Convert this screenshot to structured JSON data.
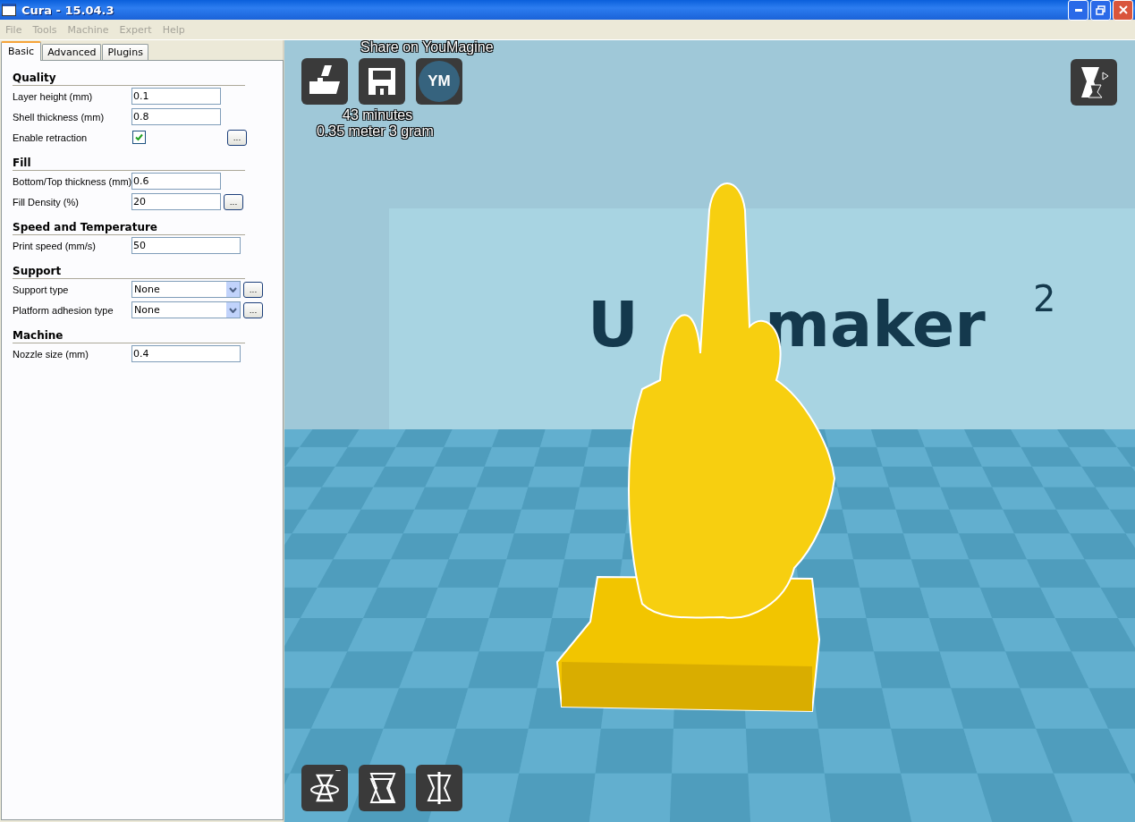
{
  "window": {
    "title": "Cura - 15.04.3"
  },
  "menu": [
    "File",
    "Tools",
    "Machine",
    "Expert",
    "Help"
  ],
  "tabs": [
    {
      "label": "Basic",
      "selected": true
    },
    {
      "label": "Advanced",
      "selected": false
    },
    {
      "label": "Plugins",
      "selected": false
    }
  ],
  "sections": [
    {
      "title": "Quality",
      "rows": [
        {
          "kind": "text",
          "label": "Layer height (mm)",
          "value": "0.1"
        },
        {
          "kind": "text",
          "label": "Shell thickness (mm)",
          "value": "0.8"
        },
        {
          "kind": "check",
          "label": "Enable retraction",
          "checked": true,
          "more_button": "..."
        }
      ]
    },
    {
      "title": "Fill",
      "rows": [
        {
          "kind": "text",
          "label": "Bottom/Top thickness (mm)",
          "value": "0.6"
        },
        {
          "kind": "text",
          "label": "Fill Density (%)",
          "value": "20",
          "more_button": "..."
        }
      ]
    },
    {
      "title": "Speed and Temperature",
      "rows": [
        {
          "kind": "text",
          "label": "Print speed (mm/s)",
          "value": "50",
          "wide": true
        }
      ]
    },
    {
      "title": "Support",
      "rows": [
        {
          "kind": "select",
          "label": "Support type",
          "value": "None",
          "more_button": "..."
        },
        {
          "kind": "select",
          "label": "Platform adhesion type",
          "value": "None",
          "more_button": "..."
        }
      ]
    },
    {
      "title": "Machine",
      "rows": [
        {
          "kind": "text",
          "label": "Nozzle size (mm)",
          "value": "0.4",
          "wide": true
        }
      ]
    }
  ],
  "viewport": {
    "share_label": "Share on YouMagine",
    "youmagine_button": "YM",
    "print_time": "43 minutes",
    "material": "0.35 meter 3 gram",
    "wall_logo": {
      "first": "U",
      "rest": "maker",
      "superscript": "2"
    }
  }
}
